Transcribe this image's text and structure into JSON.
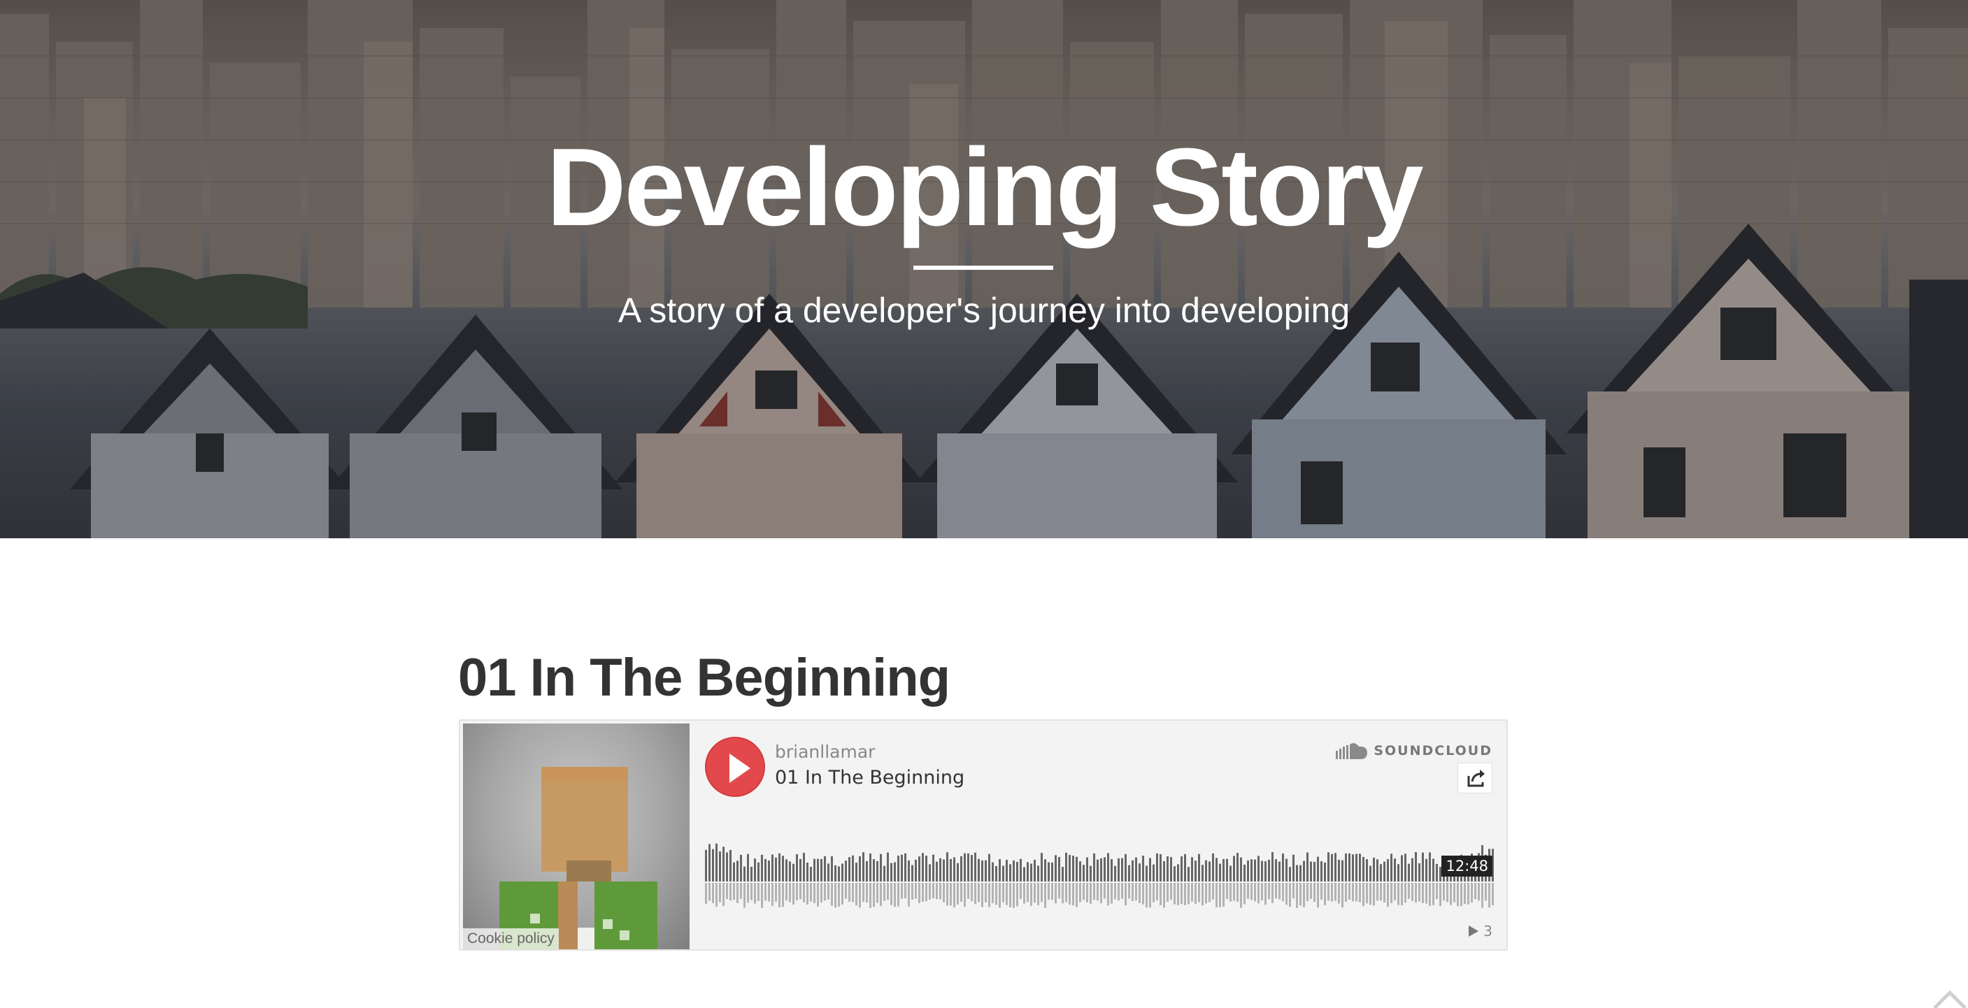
{
  "hero": {
    "title": "Developing Story",
    "subtitle": "A story of a developer's journey into developing",
    "background": "san-francisco-painted-ladies-photo"
  },
  "post": {
    "title": "01 In The Beginning"
  },
  "player": {
    "uploader": "brianllamar",
    "track_title": "01 In The Beginning",
    "brand": "SOUNDCLOUD",
    "duration": "12:48",
    "plays": "3",
    "cookie_link": "Cookie policy",
    "play_icon": "play-icon",
    "share_icon": "share-icon",
    "brand_icon": "soundcloud-logo-icon",
    "plays_icon": "plays-count-icon",
    "accent_color": "#e3494c"
  },
  "scroll_top": {
    "icon": "chevron-up-icon"
  }
}
